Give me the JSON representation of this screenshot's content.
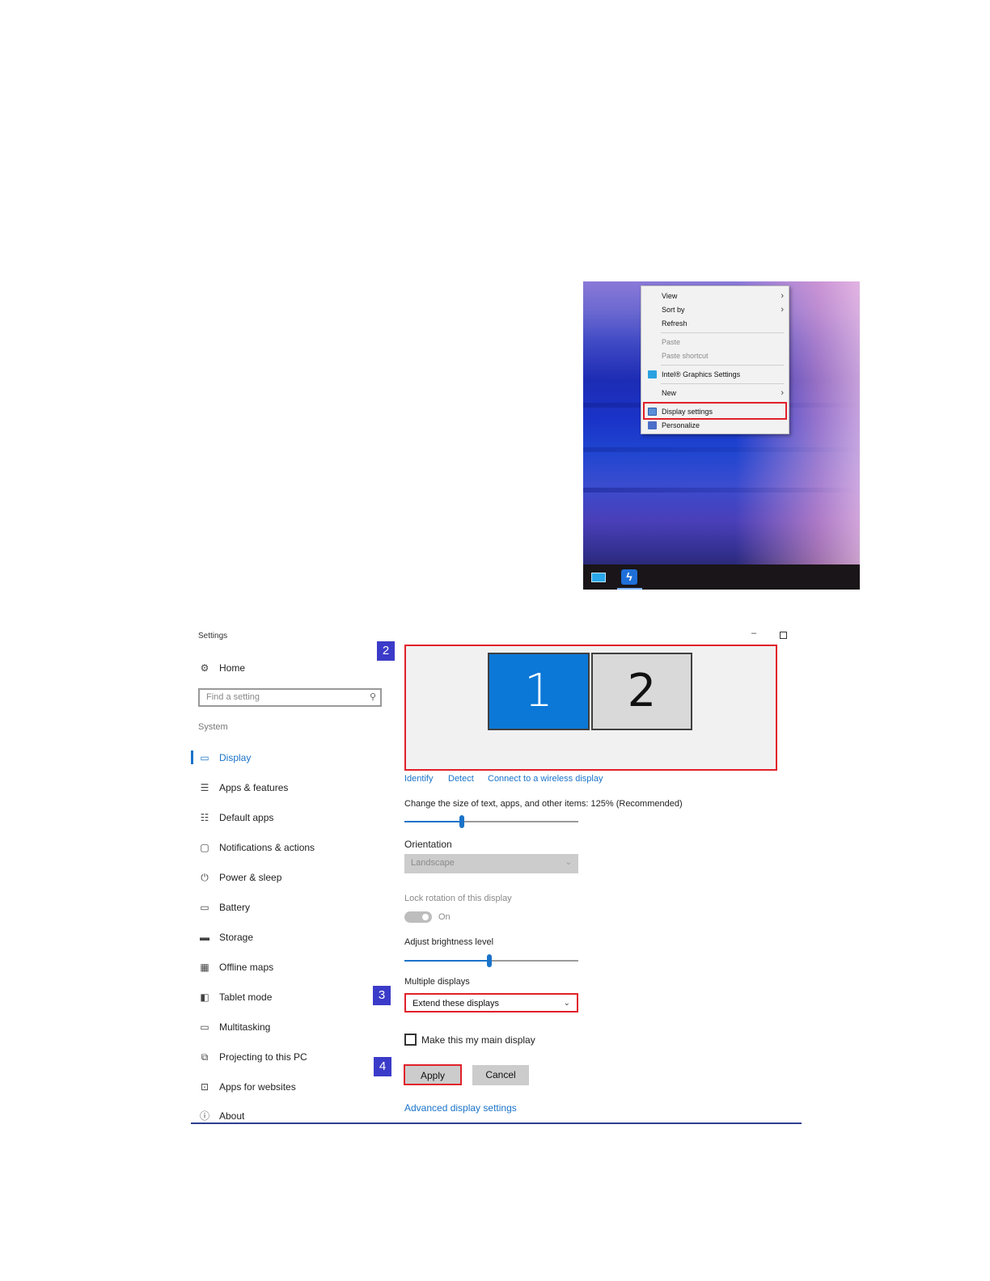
{
  "context_menu": {
    "items": [
      {
        "label": "View",
        "submenu": true,
        "enabled": true
      },
      {
        "label": "Sort by",
        "submenu": true,
        "enabled": true
      },
      {
        "label": "Refresh",
        "submenu": false,
        "enabled": true
      },
      {
        "label": "Paste",
        "submenu": false,
        "enabled": false
      },
      {
        "label": "Paste shortcut",
        "submenu": false,
        "enabled": false
      },
      {
        "label": "Intel® Graphics Settings",
        "submenu": false,
        "enabled": true,
        "icon": "intel-graphics-icon"
      },
      {
        "label": "New",
        "submenu": true,
        "enabled": true
      },
      {
        "label": "Display settings",
        "submenu": false,
        "enabled": true,
        "icon": "display-settings-icon",
        "highlighted": true
      },
      {
        "label": "Personalize",
        "submenu": false,
        "enabled": true,
        "icon": "personalize-icon"
      }
    ],
    "submenu_arrow": "›"
  },
  "settings": {
    "window_title": "Settings",
    "minimize_glyph": "–",
    "nav": {
      "home": "Home",
      "search_placeholder": "Find a setting",
      "section_label": "System",
      "items": [
        {
          "label": "Display",
          "icon": "monitor-icon",
          "active": true
        },
        {
          "label": "Apps & features",
          "icon": "list-icon"
        },
        {
          "label": "Default apps",
          "icon": "default-apps-icon"
        },
        {
          "label": "Notifications & actions",
          "icon": "notification-icon"
        },
        {
          "label": "Power & sleep",
          "icon": "power-icon"
        },
        {
          "label": "Battery",
          "icon": "battery-icon"
        },
        {
          "label": "Storage",
          "icon": "storage-icon"
        },
        {
          "label": "Offline maps",
          "icon": "map-icon"
        },
        {
          "label": "Tablet mode",
          "icon": "tablet-icon"
        },
        {
          "label": "Multitasking",
          "icon": "multitasking-icon"
        },
        {
          "label": "Projecting to this PC",
          "icon": "projecting-icon"
        },
        {
          "label": "Apps for websites",
          "icon": "apps-websites-icon"
        },
        {
          "label": "About",
          "icon": "info-icon"
        }
      ]
    },
    "step_badges": [
      "2",
      "3",
      "4"
    ],
    "monitors": [
      "1",
      "2"
    ],
    "links": {
      "identify": "Identify",
      "detect": "Detect",
      "connect_wireless": "Connect to a wireless display",
      "advanced": "Advanced display settings"
    },
    "scale_label": "Change the size of text, apps, and other items: 125% (Recommended)",
    "scale_slider_fraction": 0.33,
    "orientation_label": "Orientation",
    "orientation_value": "Landscape",
    "lock_rotation_label": "Lock rotation of this display",
    "lock_rotation_state": "On",
    "brightness_label": "Adjust brightness level",
    "brightness_slider_fraction": 0.49,
    "multiple_displays_label": "Multiple displays",
    "multiple_displays_value": "Extend these displays",
    "main_display_checkbox": "Make this my main display",
    "apply_button": "Apply",
    "cancel_button": "Cancel"
  },
  "colors": {
    "accent": "#1a73c9",
    "highlight_red": "#e0202a",
    "badge_blue": "#3b3bc9",
    "monitor_primary": "#0b78d7"
  }
}
